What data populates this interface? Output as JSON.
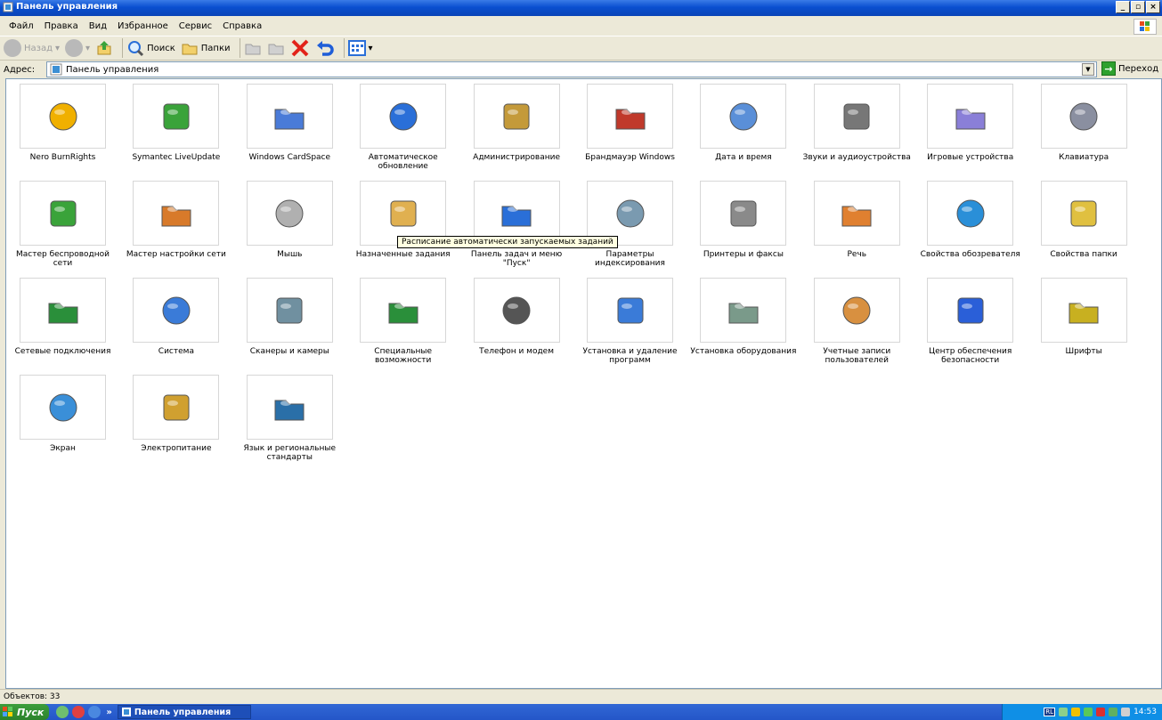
{
  "window": {
    "title": "Панель управления"
  },
  "menu": [
    "Файл",
    "Правка",
    "Вид",
    "Избранное",
    "Сервис",
    "Справка"
  ],
  "toolbar": {
    "back": "Назад",
    "search": "Поиск",
    "folders": "Папки"
  },
  "address": {
    "label": "Адрес:",
    "value": "Панель управления",
    "go": "Переход"
  },
  "items": [
    {
      "label": "Nero BurnRights",
      "icon": "disc-lock-icon"
    },
    {
      "label": "Symantec LiveUpdate",
      "icon": "liveupdate-globe-icon"
    },
    {
      "label": "Windows CardSpace",
      "icon": "cardspace-icon"
    },
    {
      "label": "Автоматическое обновление",
      "icon": "windows-update-icon"
    },
    {
      "label": "Администрирование",
      "icon": "admin-tools-icon"
    },
    {
      "label": "Брандмауэр Windows",
      "icon": "firewall-icon"
    },
    {
      "label": "Дата и время",
      "icon": "clock-calendar-icon"
    },
    {
      "label": "Звуки и аудиоустройства",
      "icon": "speaker-icon"
    },
    {
      "label": "Игровые устройства",
      "icon": "gamepad-icon"
    },
    {
      "label": "Клавиатура",
      "icon": "keyboard-icon"
    },
    {
      "label": "Мастер беспроводной сети",
      "icon": "wireless-usb-icon"
    },
    {
      "label": "Мастер настройки сети",
      "icon": "home-network-icon"
    },
    {
      "label": "Мышь",
      "icon": "mouse-icon"
    },
    {
      "label": "Назначенные задания",
      "icon": "scheduled-tasks-icon"
    },
    {
      "label": "Панель задач и меню \"Пуск\"",
      "icon": "taskbar-icon"
    },
    {
      "label": "Параметры индексирования",
      "icon": "indexing-icon"
    },
    {
      "label": "Принтеры и факсы",
      "icon": "printer-icon"
    },
    {
      "label": "Речь",
      "icon": "speech-icon"
    },
    {
      "label": "Свойства обозревателя",
      "icon": "internet-options-icon"
    },
    {
      "label": "Свойства папки",
      "icon": "folder-options-icon"
    },
    {
      "label": "Сетевые подключения",
      "icon": "network-connections-icon"
    },
    {
      "label": "Система",
      "icon": "system-icon"
    },
    {
      "label": "Сканеры и камеры",
      "icon": "scanner-camera-icon"
    },
    {
      "label": "Специальные возможности",
      "icon": "accessibility-icon"
    },
    {
      "label": "Телефон и модем",
      "icon": "phone-modem-icon"
    },
    {
      "label": "Установка и удаление программ",
      "icon": "add-remove-programs-icon"
    },
    {
      "label": "Установка оборудования",
      "icon": "add-hardware-icon"
    },
    {
      "label": "Учетные записи пользователей",
      "icon": "user-accounts-icon"
    },
    {
      "label": "Центр обеспечения безопасности",
      "icon": "security-center-icon"
    },
    {
      "label": "Шрифты",
      "icon": "fonts-folder-icon"
    },
    {
      "label": "Экран",
      "icon": "display-icon"
    },
    {
      "label": "Электропитание",
      "icon": "power-options-icon"
    },
    {
      "label": "Язык и региональные стандарты",
      "icon": "regional-globe-icon"
    }
  ],
  "tooltip": "Расписание автоматически запускаемых заданий",
  "status": "Объектов: 33",
  "taskbar": {
    "start": "Пуск",
    "task": "Панель управления",
    "lang": "RL",
    "clock": "14:53"
  }
}
